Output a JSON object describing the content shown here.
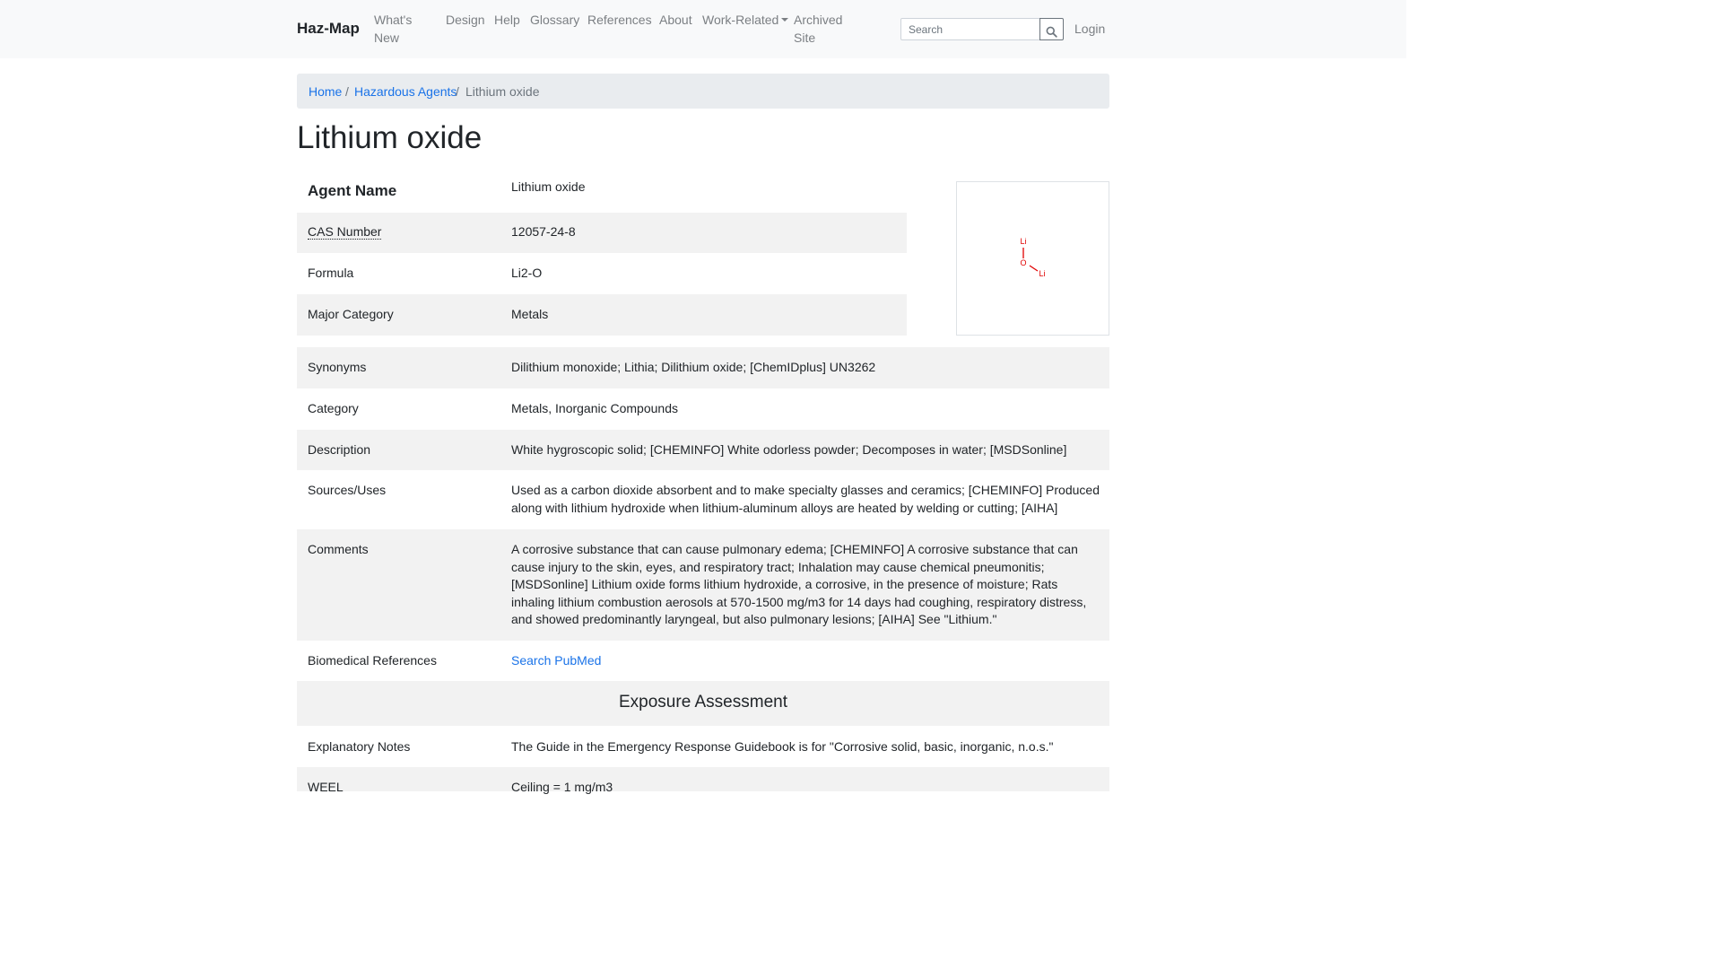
{
  "navbar": {
    "brand": "Haz-Map",
    "links": [
      {
        "label": "What's New"
      },
      {
        "label": "Design"
      },
      {
        "label": "Help"
      },
      {
        "label": "Glossary"
      },
      {
        "label": "References"
      },
      {
        "label": "About"
      },
      {
        "label": "Work-Related"
      },
      {
        "label": "Archived Site"
      }
    ],
    "search_placeholder": "Search",
    "search_icon": "magnifier-icon",
    "login": "Login"
  },
  "breadcrumb": {
    "home": "Home",
    "agents": "Hazardous Agents",
    "current": "Lithium oxide",
    "separator": "/"
  },
  "page_title": "Lithium oxide",
  "structure": {
    "atom_top": "Li",
    "atom_center": "O",
    "atom_right": "Li",
    "bond_color": "#ff0000"
  },
  "properties": [
    {
      "label": "Agent Name",
      "value": "Lithium oxide"
    },
    {
      "label": "CAS Number",
      "value": "12057-24-8"
    },
    {
      "label": "Formula",
      "value": "Li2-O"
    },
    {
      "label": "Major Category",
      "value": "Metals"
    },
    {
      "label": "Synonyms",
      "value": "Dilithium monoxide; Lithia; Dilithium oxide; [ChemIDplus] UN3262"
    },
    {
      "label": "Category",
      "value": "Metals, Inorganic Compounds"
    },
    {
      "label": "Description",
      "value": "White hygroscopic solid; [CHEMINFO] White odorless powder; Decomposes in water; [MSDSonline]"
    },
    {
      "label": "Sources/Uses",
      "value": "Used as a carbon dioxide absorbent and to make specialty glasses and ceramics; [CHEMINFO] Produced along with lithium hydroxide when lithium-aluminum alloys are heated by welding or cutting; [AIHA]"
    },
    {
      "label": "Comments",
      "value": "A corrosive substance that can cause pulmonary edema; [CHEMINFO] A corrosive substance that can cause injury to the skin, eyes, and respiratory tract; Inhalation may cause chemical pneumonitis; [MSDSonline] Lithium oxide forms lithium hydroxide, a corrosive, in the presence of moisture; Rats inhaling lithium combustion aerosols at 570-1500 mg/m3 for 14 days had coughing, respiratory distress, and showed predominantly laryngeal, but also pulmonary lesions; [AIHA] See \"Lithium.\""
    },
    {
      "label": "Biomedical References",
      "value": "Search PubMed"
    }
  ],
  "exposure": {
    "heading": "Exposure Assessment",
    "rows": [
      {
        "label": "Explanatory Notes",
        "value": "The Guide in the Emergency Response Guidebook is for \"Corrosive solid, basic, inorganic, n.o.s.\""
      },
      {
        "label": "WEEL",
        "value": "Ceiling = 1 mg/m3"
      }
    ]
  }
}
